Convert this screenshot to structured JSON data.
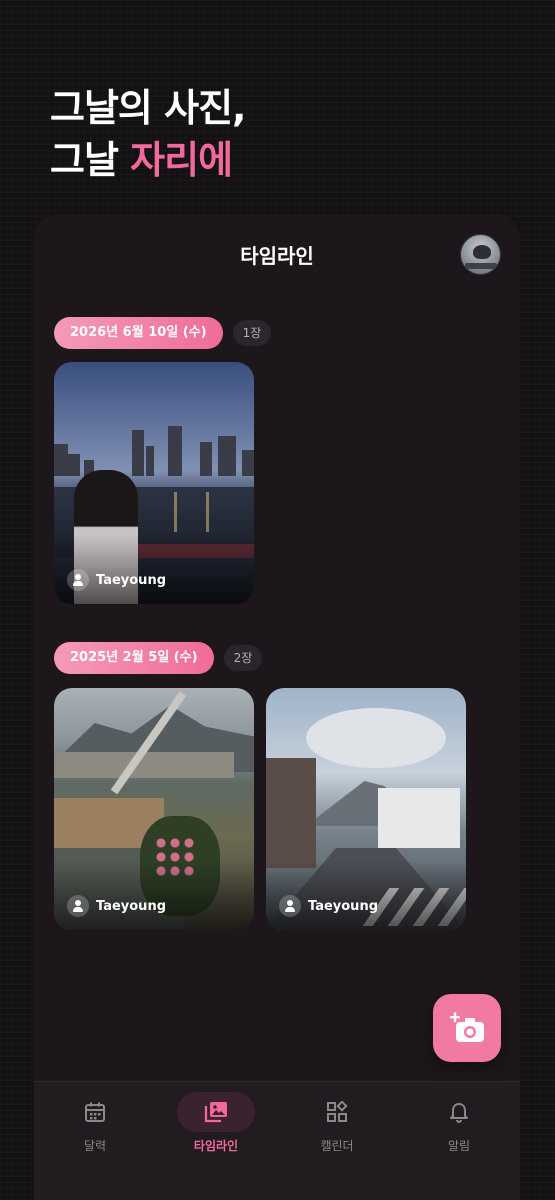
{
  "hero": {
    "line1": "그날의 사진,",
    "line2_prefix": "그날 ",
    "line2_accent": "자리에"
  },
  "header": {
    "title": "타임라인"
  },
  "groups": [
    {
      "date": "2026년 6월 10일 (수)",
      "count": "1장",
      "photos": [
        {
          "author": "Taeyoung",
          "scene": "city-lake-night"
        }
      ]
    },
    {
      "date": "2025년 2월 5일 (수)",
      "count": "2장",
      "photos": [
        {
          "author": "Taeyoung",
          "scene": "mountain-stream"
        },
        {
          "author": "Taeyoung",
          "scene": "town-street"
        }
      ]
    }
  ],
  "fab": {
    "icon": "add-photo-camera-icon"
  },
  "nav": {
    "items": [
      {
        "label": "달력",
        "icon": "calendar-icon",
        "active": false
      },
      {
        "label": "타임라인",
        "icon": "photo-library-icon",
        "active": true
      },
      {
        "label": "캘린더",
        "icon": "widgets-icon",
        "active": false
      },
      {
        "label": "알림",
        "icon": "bell-icon",
        "active": false
      }
    ]
  },
  "colors": {
    "accent": "#f26a9b",
    "background": "#141114",
    "card": "#1d171c"
  }
}
